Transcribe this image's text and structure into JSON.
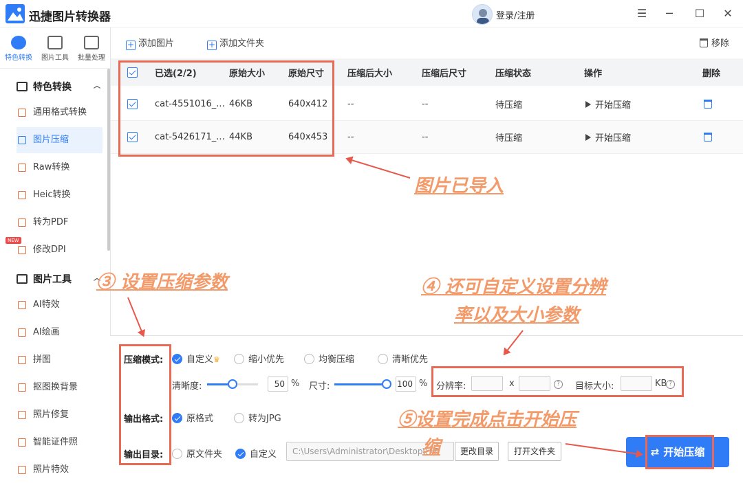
{
  "window": {
    "title": "迅捷图片转换器",
    "login": "登录/注册"
  },
  "iconbar": [
    "特色转换",
    "图片工具",
    "批量处理"
  ],
  "sidebar": {
    "section1": "特色转换",
    "items1": [
      "通用格式转换",
      "图片压缩",
      "Raw转换",
      "Heic转换",
      "转为PDF",
      "修改DPI"
    ],
    "new_badge": "NEW",
    "section2": "图片工具",
    "items2": [
      "AI特效",
      "AI绘画",
      "拼图",
      "抠图换背景",
      "照片修复",
      "智能证件照",
      "照片特效"
    ]
  },
  "toolbar": {
    "add_image": "添加图片",
    "add_folder": "添加文件夹",
    "remove": "移除"
  },
  "table": {
    "headers": [
      "已选(2/2)",
      "原始大小",
      "原始尺寸",
      "压缩后大小",
      "压缩后尺寸",
      "压缩状态",
      "操作",
      "删除"
    ],
    "rows": [
      {
        "name": "cat-4551016_...",
        "size": "46KB",
        "dim": "640x412",
        "new_size": "--",
        "new_dim": "--",
        "status": "待压缩",
        "action": "开始压缩"
      },
      {
        "name": "cat-5426171_...",
        "size": "44KB",
        "dim": "640x453",
        "new_size": "--",
        "new_dim": "--",
        "status": "待压缩",
        "action": "开始压缩"
      }
    ]
  },
  "annotations": {
    "imported": "图片已导入",
    "step3": "③ 设置压缩参数",
    "step4_line1": "④ 还可自定义设置分辨",
    "step4_line2": "率以及大小参数",
    "step5_line1": "⑤设置完成点击开始压",
    "step5_line2": "缩"
  },
  "settings": {
    "mode_label": "压缩模式:",
    "modes": [
      "自定义",
      "缩小优先",
      "均衡压缩",
      "清晰优先"
    ],
    "clarity_label": "清晰度:",
    "clarity_value": "50",
    "percent": "%",
    "size_label": "尺寸:",
    "size_value": "100",
    "resolution_label": "分辨率:",
    "x": "x",
    "target_label": "目标大小:",
    "kb": "KB",
    "qmark": "?",
    "format_label": "输出格式:",
    "formats": [
      "原格式",
      "转为JPG"
    ],
    "dir_label": "输出目录:",
    "dirs": [
      "原文件夹",
      "自定义"
    ],
    "path": "C:\\Users\\Administrator\\Desktop\\压F",
    "change_dir": "更改目录",
    "open_folder": "打开文件夹",
    "start": "开始压缩"
  },
  "colors": {
    "accent": "#2f7cf6",
    "annotation": "#f39a6a",
    "highlight_box": "#e86a55"
  }
}
